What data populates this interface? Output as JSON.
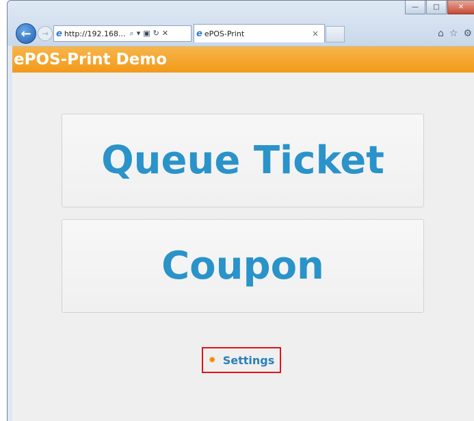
{
  "browser": {
    "address": "http://192.168...",
    "tab_title": "ePOS-Print",
    "tab_close": "×",
    "controls": {
      "minimize": "—",
      "maximize": "□",
      "close": "✕"
    },
    "tools": {
      "home": "⌂",
      "favorites": "☆",
      "settings": "⚙"
    },
    "address_tools": {
      "search": "⌕",
      "dropdown": "▾",
      "compat": "▣",
      "refresh": "↻",
      "stop": "✕"
    }
  },
  "page": {
    "header_title": "ePOS-Print Demo",
    "buttons": {
      "queue_ticket": "Queue Ticket",
      "coupon": "Coupon",
      "settings": "Settings"
    }
  },
  "colors": {
    "header": "#f29a1a",
    "button_text": "#2a93c9",
    "highlight": "#e0141b"
  }
}
